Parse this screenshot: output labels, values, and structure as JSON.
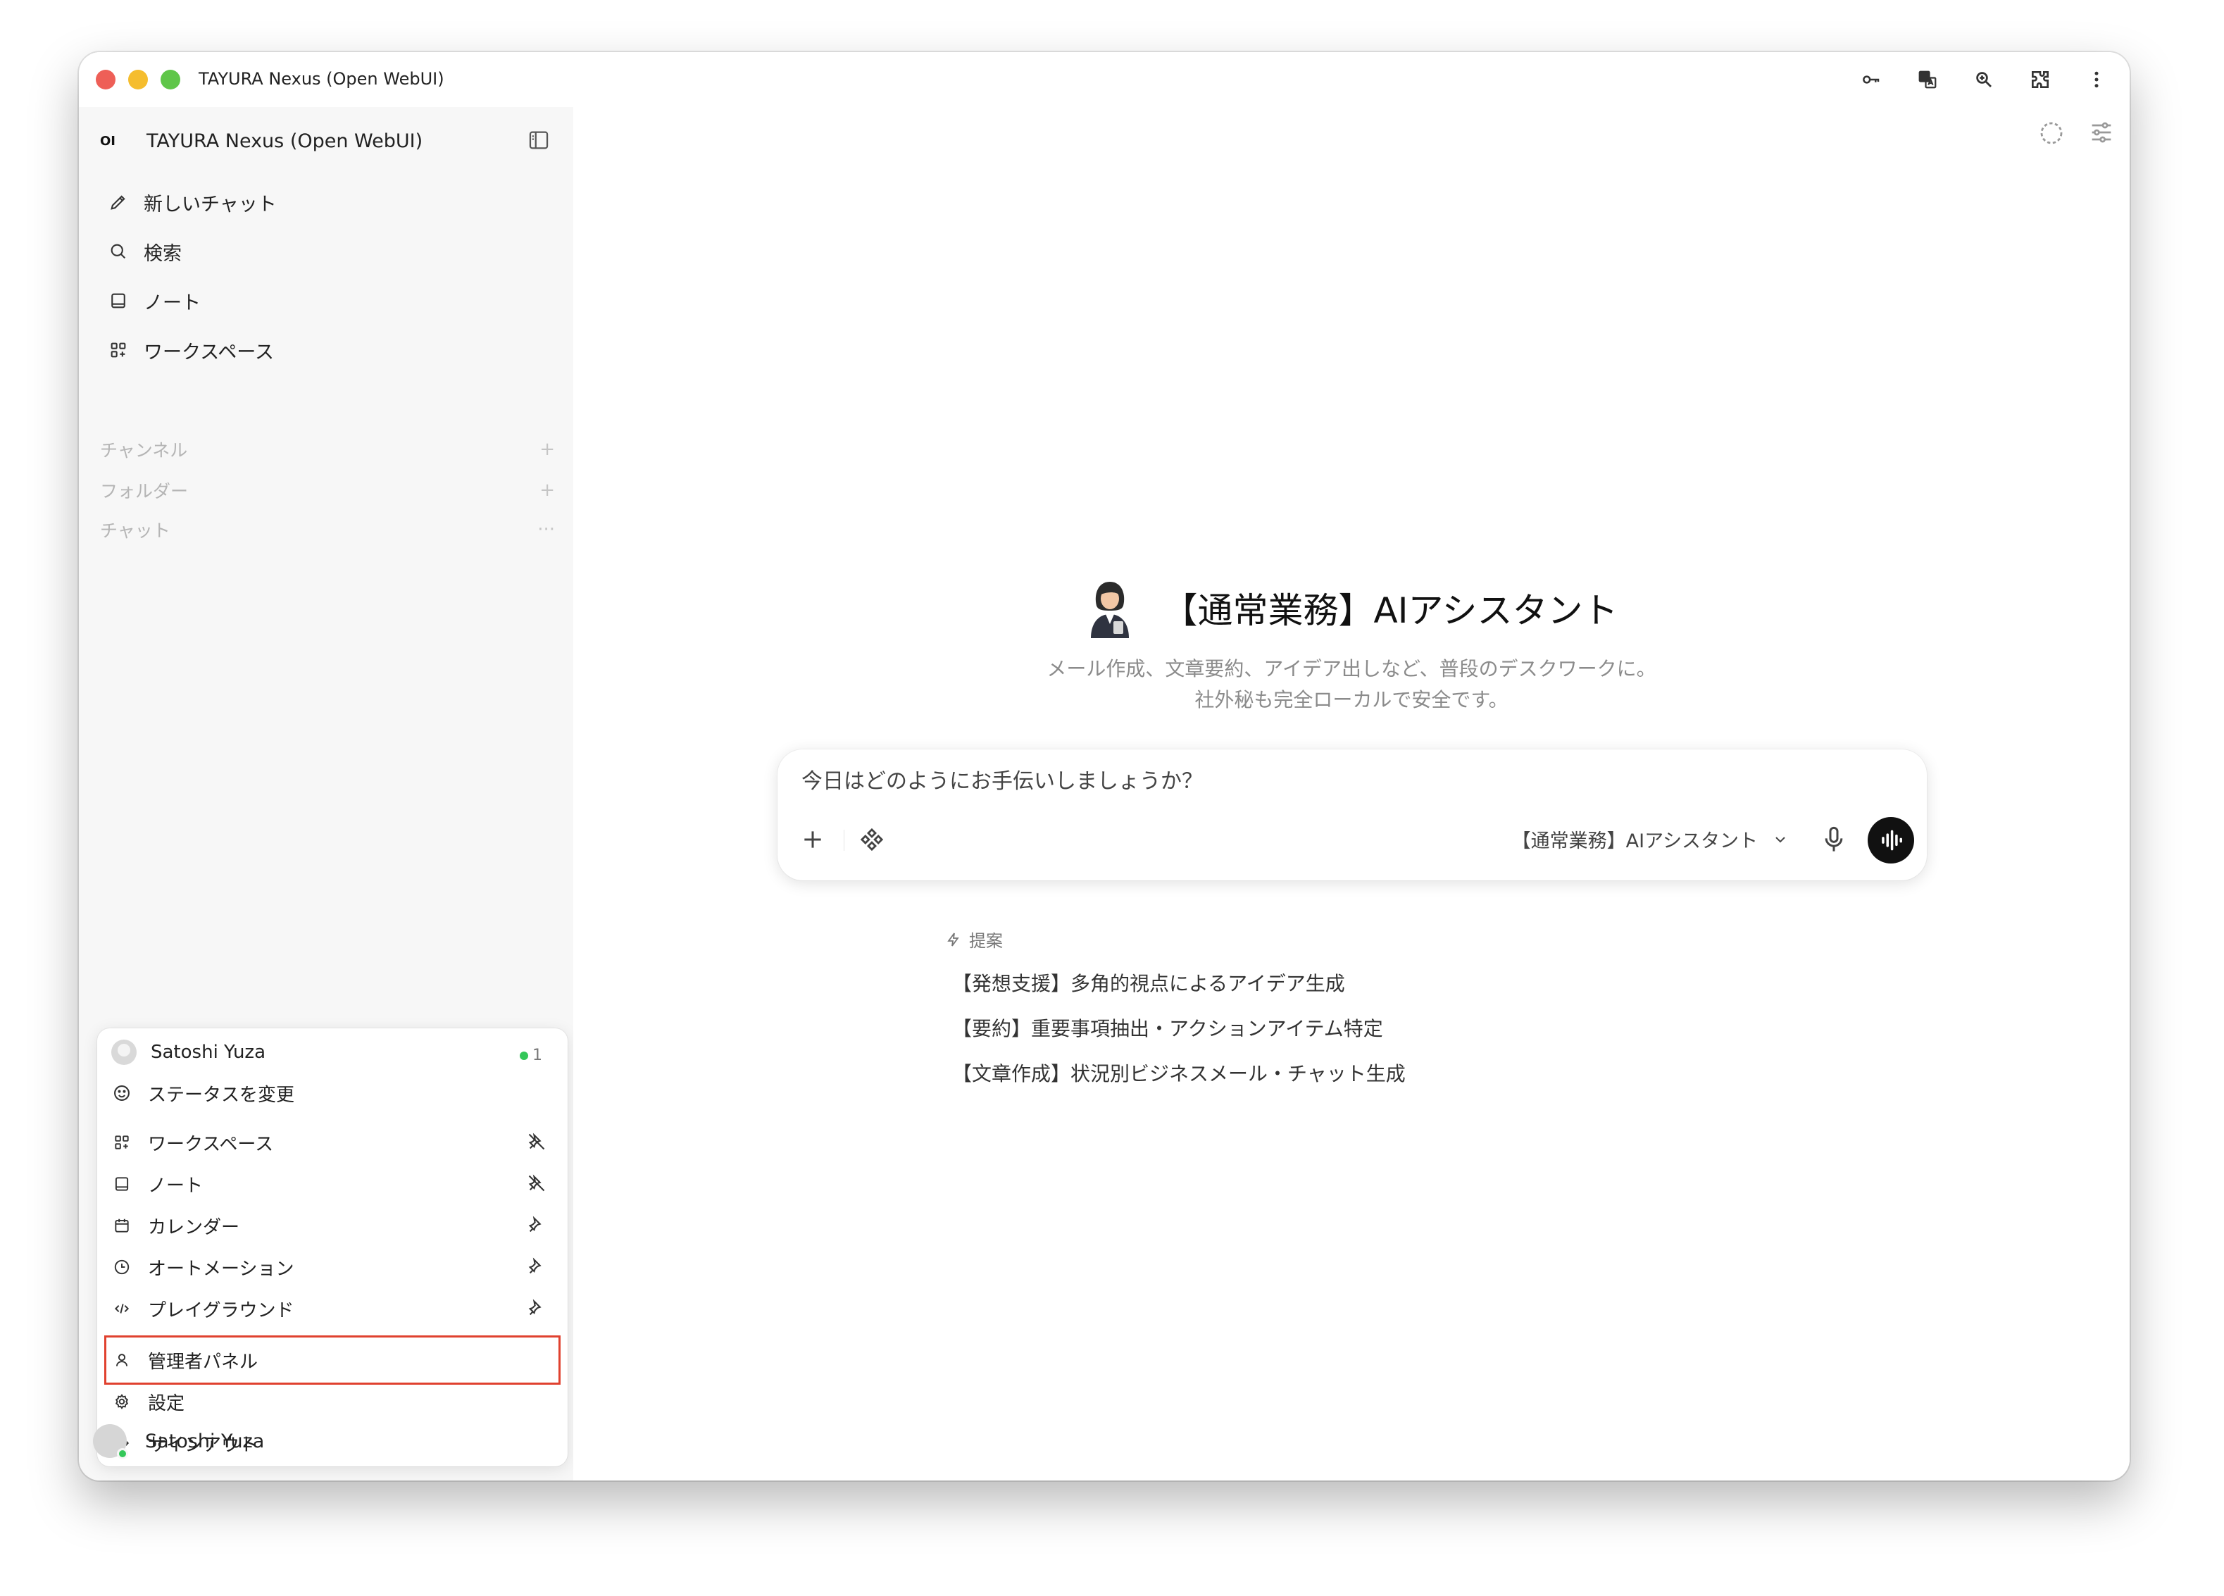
{
  "window": {
    "title": "TAYURA Nexus (Open WebUI)",
    "toolbar_icons": [
      "key-icon",
      "translate-icon",
      "zoom-icon",
      "extension-icon",
      "more-vert-icon"
    ]
  },
  "sidebar": {
    "logo": "OI",
    "brand": "TAYURA Nexus (Open WebUI)",
    "nav": [
      {
        "label": "新しいチャット",
        "icon": "pencil-icon"
      },
      {
        "label": "検索",
        "icon": "search-icon"
      },
      {
        "label": "ノート",
        "icon": "note-icon"
      },
      {
        "label": "ワークスペース",
        "icon": "grid-icon"
      }
    ],
    "sections": [
      {
        "label": "チャンネル",
        "action": "+"
      },
      {
        "label": "フォルダー",
        "action": "+"
      },
      {
        "label": "チャット",
        "action": "···"
      }
    ],
    "footer_user": "Satoshi Yuza"
  },
  "user_menu": {
    "user": "Satoshi Yuza",
    "online_count": "1",
    "change_status": "ステータスを変更",
    "items": [
      {
        "label": "ワークスペース",
        "icon": "grid-icon",
        "pin": "unpin-icon"
      },
      {
        "label": "ノート",
        "icon": "note-icon",
        "pin": "unpin-icon"
      },
      {
        "label": "カレンダー",
        "icon": "calendar-icon",
        "pin": "pin-icon"
      },
      {
        "label": "オートメーション",
        "icon": "clock-icon",
        "pin": "pin-icon"
      },
      {
        "label": "プレイグラウンド",
        "icon": "code-icon",
        "pin": "pin-icon"
      }
    ],
    "admin_panel": "管理者パネル",
    "settings": "設定",
    "sign_out": "サインアウト",
    "highlight_color": "#e0412f"
  },
  "main": {
    "assistant_title": "【通常業務】AIアシスタント",
    "subtitle_line1": "メール作成、文章要約、アイデア出しなど、普段のデスクワークに。",
    "subtitle_line2": "社外秘も完全ローカルで安全です。",
    "composer": {
      "placeholder": "今日はどのようにお手伝いしましょうか？",
      "model": "【通常業務】AIアシスタント"
    },
    "suggestions_label": "提案",
    "suggestions": [
      "【発想支援】多角的視点によるアイデア生成",
      "【要約】重要事項抽出・アクションアイテム特定",
      "【文章作成】状況別ビジネスメール・チャット生成"
    ]
  }
}
